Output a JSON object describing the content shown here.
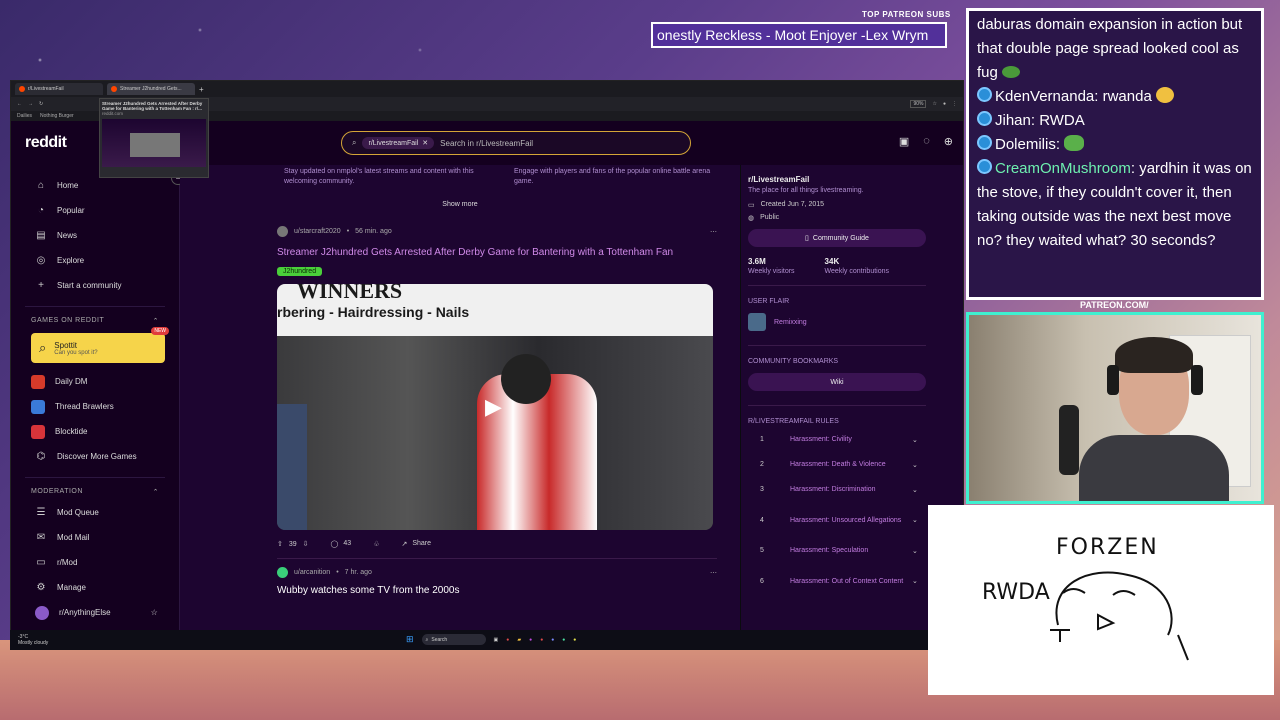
{
  "overlay": {
    "top_patreon_subs_label": "TOP PATREON SUBS",
    "ticker_text": "onestly Reckless - Moot Enjoyer -Lex Wrym",
    "patreon_label": "PATREON.COM/",
    "chat": [
      {
        "text": "daburas domain expansion in action but that double page spread looked cool as fug"
      },
      {
        "user": "KdenVernanda",
        "text": "rwanda"
      },
      {
        "user": "Jihan",
        "text": "RWDA"
      },
      {
        "user": "Dolemilis",
        "text": ""
      },
      {
        "user": "CreamOnMushroom",
        "text": "yardhin it was on the stove, if they couldn't cover it, then taking outside was the next best move no? they waited what? 30 seconds?"
      }
    ],
    "drawing": {
      "title": "FORZEN",
      "side": "RWDA"
    }
  },
  "browser": {
    "tabs": [
      {
        "label": "r/LivestreamFail"
      },
      {
        "label": "Streamer J2hundred Gets..."
      }
    ],
    "tab_preview": "Streamer J2hundred Gets Arrested After Derby Game for Bantering with a Tottenham Fan : r/...",
    "tab_preview_domain": "reddit.com",
    "zoom": "90%",
    "bookmarks": [
      "Dailies",
      "Nothing Burger"
    ]
  },
  "reddit": {
    "logo": "reddit",
    "search_chip": "r/LivestreamFail",
    "search_placeholder": "Search in r/LivestreamFail",
    "sidebar": {
      "nav": [
        {
          "label": "Home",
          "icon": "home-icon"
        },
        {
          "label": "Popular",
          "icon": "popular-icon"
        },
        {
          "label": "News",
          "icon": "news-icon"
        },
        {
          "label": "Explore",
          "icon": "explore-icon"
        },
        {
          "label": "Start a community",
          "icon": "plus-icon"
        }
      ],
      "games_heading": "GAMES ON REDDIT",
      "spottit": {
        "title": "Spottit",
        "subtitle": "Can you spot it?",
        "badge": "NEW"
      },
      "games": [
        {
          "label": "Daily DM",
          "color": "#d63a2a"
        },
        {
          "label": "Thread Brawlers",
          "color": "#3a7ad8"
        },
        {
          "label": "Blocktide",
          "color": "#d8343a"
        },
        {
          "label": "Discover More Games",
          "color": ""
        }
      ],
      "moderation_heading": "MODERATION",
      "moderation": [
        "Mod Queue",
        "Mod Mail",
        "r/Mod",
        "Manage",
        "r/AnythingElse"
      ]
    },
    "promo": {
      "left": "Stay updated on nmplol's latest streams and content with this welcoming community.",
      "right": "Engage with players and fans of the popular online battle arena game."
    },
    "show_more": "Show more",
    "post": {
      "author": "u/starcraft2020",
      "time": "56 min. ago",
      "title": "Streamer J2hundred Gets Arrested After Derby Game for Bantering with a Tottenham Fan",
      "flair": "J2hundred",
      "media_sign_line1": "WINNERS",
      "media_sign_line2": "rbering - Hairdressing - Nails",
      "votes": "39",
      "comments": "43",
      "share": "Share"
    },
    "next_post": {
      "author": "u/arcanition",
      "time": "7 hr. ago",
      "title": "Wubby watches some TV from the 2000s"
    },
    "community": {
      "name": "r/LivestreamFail",
      "tagline": "The place for all things livestreaming.",
      "created": "Created Jun 7, 2015",
      "visibility": "Public",
      "guide_button": "Community Guide",
      "visitors": "3.6M",
      "visitors_label": "Weekly visitors",
      "contributions": "34K",
      "contributions_label": "Weekly contributions",
      "user_flair_heading": "USER FLAIR",
      "user_flair": "Remixxing",
      "bookmarks_heading": "COMMUNITY BOOKMARKS",
      "wiki": "Wiki",
      "rules_heading": "R/LIVESTREAMFAIL RULES",
      "rules": [
        {
          "n": "1",
          "t": "Harassment: Civility"
        },
        {
          "n": "2",
          "t": "Harassment: Death & Violence"
        },
        {
          "n": "3",
          "t": "Harassment: Discrimination"
        },
        {
          "n": "4",
          "t": "Harassment: Unsourced Allegations"
        },
        {
          "n": "5",
          "t": "Harassment: Speculation"
        },
        {
          "n": "6",
          "t": "Harassment: Out of Context Content"
        }
      ]
    }
  },
  "taskbar": {
    "weather": "-3°C",
    "weather_desc": "Mostly cloudy",
    "search": "Search"
  }
}
